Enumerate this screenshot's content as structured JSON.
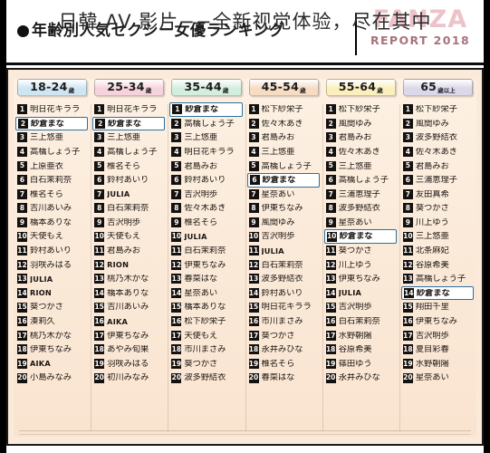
{
  "header": {
    "bullet_icon": "filled-circle-icon",
    "title": "●年齢別人気セクシー女優ランキング",
    "title_text": "年齢別人気セクシー女優ランキング",
    "logo_word": "FANZA",
    "logo_sub": "REPORT 2018",
    "logo_color": "#edc3c9"
  },
  "overlay": {
    "text": "日韓 AV 影片−−全新视觉体验，尽在其中"
  },
  "colors": {
    "panel_bg": "#fbead9",
    "highlight_border": "#2f6f9e",
    "badge_bg": "#15110f",
    "frame": "#000000"
  },
  "columns": [
    {
      "id": "age-18-24",
      "age_main": "18-24",
      "age_suffix": "歳",
      "chip_color": "#cfe6f2",
      "highlight_rank": 2,
      "entries": [
        {
          "rank": "1",
          "name": "明日花キララ"
        },
        {
          "rank": "2",
          "name": "紗倉まな"
        },
        {
          "rank": "3",
          "name": "三上悠亜"
        },
        {
          "rank": "4",
          "name": "高橋しょう子"
        },
        {
          "rank": "5",
          "name": "上原亜衣"
        },
        {
          "rank": "6",
          "name": "白石茉莉奈"
        },
        {
          "rank": "7",
          "name": "椎名そら"
        },
        {
          "rank": "8",
          "name": "吉川あいみ"
        },
        {
          "rank": "9",
          "name": "橋本ありな"
        },
        {
          "rank": "10",
          "name": "天使もえ"
        },
        {
          "rank": "11",
          "name": "鈴村あいり"
        },
        {
          "rank": "12",
          "name": "羽咲みはる"
        },
        {
          "rank": "13",
          "name": "JULIA",
          "latin": true
        },
        {
          "rank": "14",
          "name": "RION",
          "latin": true
        },
        {
          "rank": "15",
          "name": "葵つかさ"
        },
        {
          "rank": "16",
          "name": "湊莉久"
        },
        {
          "rank": "17",
          "name": "桃乃木かな"
        },
        {
          "rank": "18",
          "name": "伊東ちなみ"
        },
        {
          "rank": "19",
          "name": "AIKA",
          "latin": true
        },
        {
          "rank": "20",
          "name": "小島みなみ"
        }
      ]
    },
    {
      "id": "age-25-34",
      "age_main": "25-34",
      "age_suffix": "歳",
      "chip_color": "#f6d3dc",
      "highlight_rank": 2,
      "entries": [
        {
          "rank": "1",
          "name": "明日花キララ"
        },
        {
          "rank": "2",
          "name": "紗倉まな"
        },
        {
          "rank": "3",
          "name": "三上悠亜"
        },
        {
          "rank": "4",
          "name": "高橋しょう子"
        },
        {
          "rank": "5",
          "name": "椎名そら"
        },
        {
          "rank": "6",
          "name": "鈴村あいり"
        },
        {
          "rank": "7",
          "name": "JULIA",
          "latin": true
        },
        {
          "rank": "8",
          "name": "白石茉莉奈"
        },
        {
          "rank": "9",
          "name": "吉沢明歩"
        },
        {
          "rank": "10",
          "name": "天使もえ"
        },
        {
          "rank": "11",
          "name": "君島みお"
        },
        {
          "rank": "12",
          "name": "RION",
          "latin": true
        },
        {
          "rank": "13",
          "name": "桃乃木かな"
        },
        {
          "rank": "14",
          "name": "橋本ありな"
        },
        {
          "rank": "15",
          "name": "吉川あいみ"
        },
        {
          "rank": "16",
          "name": "AIKA",
          "latin": true
        },
        {
          "rank": "17",
          "name": "伊東ちなみ"
        },
        {
          "rank": "18",
          "name": "あやみ旬果"
        },
        {
          "rank": "19",
          "name": "羽咲みはる"
        },
        {
          "rank": "20",
          "name": "初川みなみ"
        }
      ]
    },
    {
      "id": "age-35-44",
      "age_main": "35-44",
      "age_suffix": "歳",
      "chip_color": "#d3eedd",
      "highlight_rank": 1,
      "entries": [
        {
          "rank": "1",
          "name": "紗倉まな"
        },
        {
          "rank": "2",
          "name": "高橋しょう子"
        },
        {
          "rank": "3",
          "name": "三上悠亜"
        },
        {
          "rank": "4",
          "name": "明日花キララ"
        },
        {
          "rank": "5",
          "name": "君島みお"
        },
        {
          "rank": "6",
          "name": "鈴村あいり"
        },
        {
          "rank": "7",
          "name": "吉沢明歩"
        },
        {
          "rank": "8",
          "name": "佐々木あき"
        },
        {
          "rank": "9",
          "name": "椎名そら"
        },
        {
          "rank": "10",
          "name": "JULIA",
          "latin": true
        },
        {
          "rank": "11",
          "name": "白石茉莉奈"
        },
        {
          "rank": "12",
          "name": "伊東ちなみ"
        },
        {
          "rank": "13",
          "name": "春菜はな"
        },
        {
          "rank": "14",
          "name": "星奈あい"
        },
        {
          "rank": "15",
          "name": "橋本ありな"
        },
        {
          "rank": "16",
          "name": "松下紗栄子"
        },
        {
          "rank": "17",
          "name": "天使もえ"
        },
        {
          "rank": "18",
          "name": "市川まさみ"
        },
        {
          "rank": "19",
          "name": "葵つかさ"
        },
        {
          "rank": "20",
          "name": "波多野結衣"
        }
      ]
    },
    {
      "id": "age-45-54",
      "age_main": "45-54",
      "age_suffix": "歳",
      "chip_color": "#f7dcc4",
      "highlight_rank": 6,
      "entries": [
        {
          "rank": "1",
          "name": "松下紗栄子"
        },
        {
          "rank": "2",
          "name": "佐々木あき"
        },
        {
          "rank": "3",
          "name": "君島みお"
        },
        {
          "rank": "4",
          "name": "三上悠亜"
        },
        {
          "rank": "5",
          "name": "高橋しょう子"
        },
        {
          "rank": "6",
          "name": "紗倉まな"
        },
        {
          "rank": "7",
          "name": "星奈あい"
        },
        {
          "rank": "8",
          "name": "伊東ちなみ"
        },
        {
          "rank": "9",
          "name": "風間ゆみ"
        },
        {
          "rank": "10",
          "name": "吉沢明歩"
        },
        {
          "rank": "11",
          "name": "JULIA",
          "latin": true
        },
        {
          "rank": "12",
          "name": "白石茉莉奈"
        },
        {
          "rank": "13",
          "name": "波多野結衣"
        },
        {
          "rank": "14",
          "name": "鈴村あいり"
        },
        {
          "rank": "15",
          "name": "明日花キララ"
        },
        {
          "rank": "16",
          "name": "市川まさみ"
        },
        {
          "rank": "17",
          "name": "葵つかさ"
        },
        {
          "rank": "18",
          "name": "永井みひな"
        },
        {
          "rank": "19",
          "name": "椎名そら"
        },
        {
          "rank": "20",
          "name": "春菜はな"
        }
      ]
    },
    {
      "id": "age-55-64",
      "age_main": "55-64",
      "age_suffix": "歳",
      "chip_color": "#fbf0bd",
      "highlight_rank": 10,
      "entries": [
        {
          "rank": "1",
          "name": "松下紗栄子"
        },
        {
          "rank": "2",
          "name": "風間ゆみ"
        },
        {
          "rank": "3",
          "name": "君島みお"
        },
        {
          "rank": "4",
          "name": "佐々木あき"
        },
        {
          "rank": "5",
          "name": "三上悠亜"
        },
        {
          "rank": "6",
          "name": "高橋しょう子"
        },
        {
          "rank": "7",
          "name": "三浦恵理子"
        },
        {
          "rank": "8",
          "name": "波多野結衣"
        },
        {
          "rank": "9",
          "name": "星奈あい"
        },
        {
          "rank": "10",
          "name": "紗倉まな"
        },
        {
          "rank": "11",
          "name": "葵つかさ"
        },
        {
          "rank": "12",
          "name": "川上ゆう"
        },
        {
          "rank": "13",
          "name": "伊東ちなみ"
        },
        {
          "rank": "14",
          "name": "JULIA",
          "latin": true
        },
        {
          "rank": "15",
          "name": "吉沢明歩"
        },
        {
          "rank": "16",
          "name": "白石茉莉奈"
        },
        {
          "rank": "17",
          "name": "水野朝陽"
        },
        {
          "rank": "18",
          "name": "谷原希美"
        },
        {
          "rank": "19",
          "name": "篠田ゆう"
        },
        {
          "rank": "20",
          "name": "永井みひな"
        }
      ]
    },
    {
      "id": "age-65-plus",
      "age_main": "65",
      "age_suffix": "歳以上",
      "chip_color": "#dcd8ea",
      "highlight_rank": 14,
      "entries": [
        {
          "rank": "1",
          "name": "松下紗栄子"
        },
        {
          "rank": "2",
          "name": "風間ゆみ"
        },
        {
          "rank": "3",
          "name": "波多野結衣"
        },
        {
          "rank": "4",
          "name": "佐々木あき"
        },
        {
          "rank": "5",
          "name": "君島みお"
        },
        {
          "rank": "6",
          "name": "三浦恵理子"
        },
        {
          "rank": "7",
          "name": "友田真希"
        },
        {
          "rank": "8",
          "name": "葵つかさ"
        },
        {
          "rank": "9",
          "name": "川上ゆう"
        },
        {
          "rank": "10",
          "name": "三上悠亜"
        },
        {
          "rank": "11",
          "name": "北条麻妃"
        },
        {
          "rank": "12",
          "name": "谷原希美"
        },
        {
          "rank": "13",
          "name": "高橋しょう子"
        },
        {
          "rank": "14",
          "name": "紗倉まな"
        },
        {
          "rank": "15",
          "name": "翔田千里"
        },
        {
          "rank": "16",
          "name": "伊東ちなみ"
        },
        {
          "rank": "17",
          "name": "吉沢明歩"
        },
        {
          "rank": "18",
          "name": "夏目彩春"
        },
        {
          "rank": "19",
          "name": "水野朝陽"
        },
        {
          "rank": "20",
          "name": "星奈あい"
        }
      ]
    }
  ]
}
